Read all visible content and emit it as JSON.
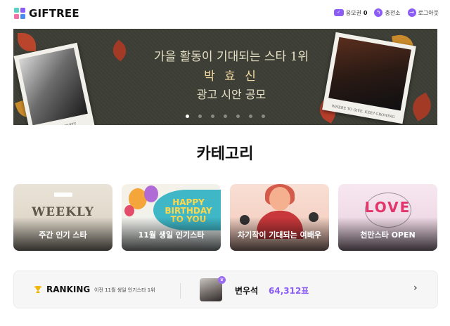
{
  "header": {
    "logo_text": "GIFTREE",
    "links": [
      {
        "icon": "ticket-icon",
        "label": "응모권",
        "count": "0"
      },
      {
        "icon": "lightning-icon",
        "label": "충전소"
      },
      {
        "icon": "logout-arrow-icon",
        "label": "로그아웃"
      }
    ]
  },
  "banner": {
    "line1": "가을 활동이 기대되는 스타 1위",
    "line2": "박 효 신",
    "line3": "광고 시안 공모",
    "polaroid_left_caption": "DREAMY PARTY",
    "polaroid_right_caption": "WHERE TO GIVE, KEEP GROWING",
    "slide_count": 7,
    "active_slide": 1
  },
  "category": {
    "title": "카테고리",
    "cards": [
      {
        "label": "주간 인기 스타",
        "art_text": "WEEKLY"
      },
      {
        "label": "11월 생일 인기스타",
        "art_text": "HAPPY BIRTHDAY TO YOU"
      },
      {
        "label": "차기작이 기대되는 여배우"
      },
      {
        "label": "천만스타 OPEN",
        "art_text": "LOVE"
      }
    ]
  },
  "ranking": {
    "title": "RANKING",
    "subtitle": "이전 11월 생일 인기스타 1위",
    "name": "변우석",
    "votes": "64,312표",
    "arrow": "›"
  },
  "colors": {
    "accent": "#8b5cf6",
    "banner_bg": "#3d3f36"
  }
}
